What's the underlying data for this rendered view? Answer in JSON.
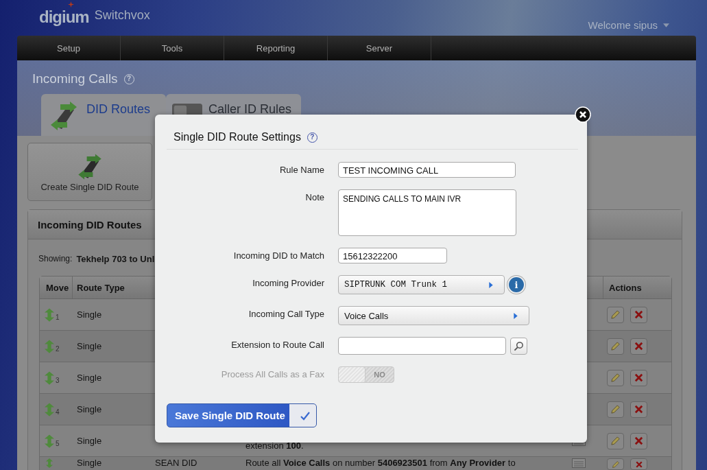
{
  "header": {
    "logo": "digium",
    "product": "Switchvox",
    "welcome": "Welcome sipus"
  },
  "nav": [
    {
      "label": "Setup"
    },
    {
      "label": "Tools"
    },
    {
      "label": "Reporting"
    },
    {
      "label": "Server"
    }
  ],
  "page": {
    "title": "Incoming Calls",
    "help": "?"
  },
  "tabs": [
    {
      "label": "DID Routes",
      "selected": true
    },
    {
      "label": "Caller ID Rules",
      "selected": false
    }
  ],
  "create_button": "Create Single DID Route",
  "routes_panel": {
    "title": "Incoming DID Routes",
    "showing_label": "Showing:",
    "showing_value": "Tekhelp 703 to Unl",
    "columns": [
      "Move",
      "Route Type",
      "Actions"
    ],
    "rows": [
      {
        "number": "1",
        "type": "Single"
      },
      {
        "number": "2",
        "type": "Single"
      },
      {
        "number": "3",
        "type": "Single"
      },
      {
        "number": "4",
        "type": "Single"
      },
      {
        "number": "5",
        "type": "Single",
        "description": "extension **100**.",
        "has_icon": true
      },
      {
        "type": "Single",
        "column_3": "SEAN DID",
        "description": "Route all **Voice Calls** on number **5406923501** from **Any Provider** to",
        "has_icon": true
      }
    ]
  },
  "dialog": {
    "title": "Single DID Route Settings",
    "help": "?",
    "fields": [
      {
        "kind": "text",
        "label": "Rule Name",
        "value": "TEST INCOMING CALL"
      },
      {
        "kind": "textarea",
        "label": "Note",
        "value": "SENDING CALLS TO MAIN IVR"
      },
      {
        "kind": "short",
        "label": "Incoming DID to Match",
        "value": "15612322200"
      },
      {
        "kind": "select",
        "label": "Incoming Provider",
        "value": "SIPTRUNK COM Trunk 1",
        "info": "i"
      },
      {
        "kind": "select",
        "label": "Incoming Call Type",
        "value": "Voice Calls"
      },
      {
        "kind": "search",
        "label": "Extension to Route Call"
      },
      {
        "kind": "toggle",
        "label": "Process All Calls as a Fax",
        "disabled": true,
        "on": false,
        "state_text": "NO"
      }
    ],
    "save_button": "Save Single DID Route"
  }
}
